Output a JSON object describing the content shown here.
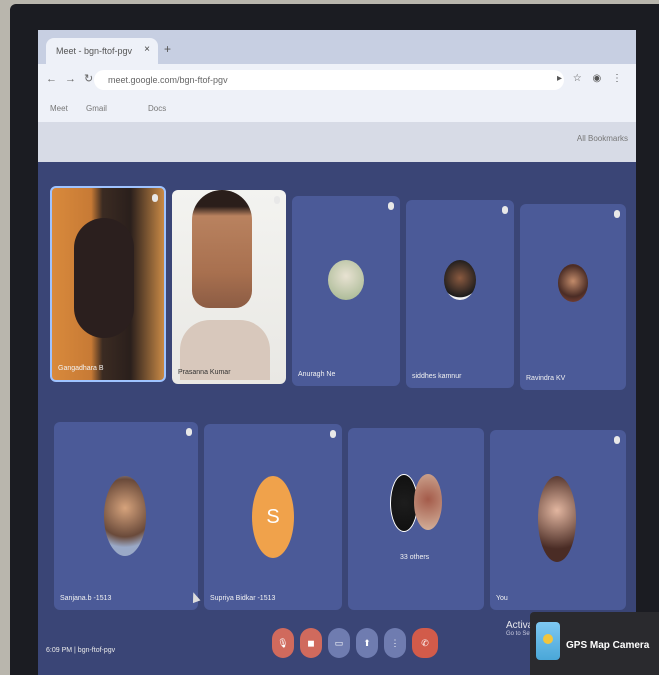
{
  "browser": {
    "tab_title": "Meet - bgn-ftof-pgv",
    "url": "meet.google.com/bgn-ftof-pgv",
    "bookmarks": [
      "Meet",
      "Gmail",
      "Docs"
    ],
    "all_bookmarks": "All Bookmarks"
  },
  "meeting": {
    "time": "6:09 PM",
    "code": "bgn-ftof-pgv",
    "participants": [
      {
        "name": "Gangadhara B",
        "type": "video"
      },
      {
        "name": "Prasanna Kumar",
        "type": "video"
      },
      {
        "name": "Anuragh Ne",
        "type": "avatar"
      },
      {
        "name": "siddhes kamnur",
        "type": "avatar"
      },
      {
        "name": "Ravindra KV",
        "type": "avatar"
      },
      {
        "name": "Sanjana.b -1513",
        "type": "avatar"
      },
      {
        "name": "Supriya Bidkar -1513",
        "type": "letter",
        "letter": "S"
      },
      {
        "name": "33 others",
        "type": "group"
      },
      {
        "name": "You",
        "type": "avatar"
      }
    ]
  },
  "controls": [
    "mic",
    "camera",
    "captions",
    "present",
    "more",
    "leave"
  ],
  "watermark": {
    "line1": "Activate Windows",
    "line2": "Go to Settings to activate Windows."
  },
  "overlay": {
    "app_name": "GPS Map Camera"
  },
  "colors": {
    "meet_bg": "#3a4576",
    "tile_bg": "#4b5a98",
    "leave_red": "#d25b4a"
  }
}
